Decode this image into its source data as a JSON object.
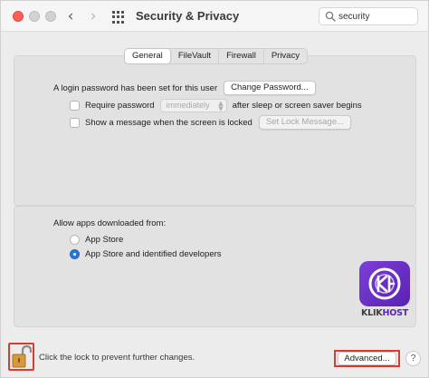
{
  "window": {
    "title": "Security & Privacy",
    "search": {
      "value": "security",
      "placeholder": "Search"
    }
  },
  "tabs": [
    {
      "label": "General",
      "active": true
    },
    {
      "label": "FileVault",
      "active": false
    },
    {
      "label": "Firewall",
      "active": false
    },
    {
      "label": "Privacy",
      "active": false
    }
  ],
  "general": {
    "login_password_text": "A login password has been set for this user",
    "change_password_button": "Change Password...",
    "require_password_label": "Require password",
    "require_password_select": "immediately",
    "require_password_suffix": "after sleep or screen saver begins",
    "show_message_label": "Show a message when the screen is locked",
    "set_lock_message_button": "Set Lock Message...",
    "allow_apps_label": "Allow apps downloaded from:",
    "radio_app_store": "App Store",
    "radio_app_store_identified": "App Store and identified developers",
    "selected_option": "App Store and identified developers"
  },
  "watermark": {
    "brand_a": "KLIK",
    "brand_b": "HOST"
  },
  "footer": {
    "lock_text": "Click the lock to prevent further changes.",
    "advanced_button": "Advanced...",
    "help_button": "?"
  },
  "colors": {
    "accent": "#2a76d9",
    "highlight_box": "#d93b2e",
    "close_button": "#fc5f57",
    "brand": "#5b25b5"
  }
}
